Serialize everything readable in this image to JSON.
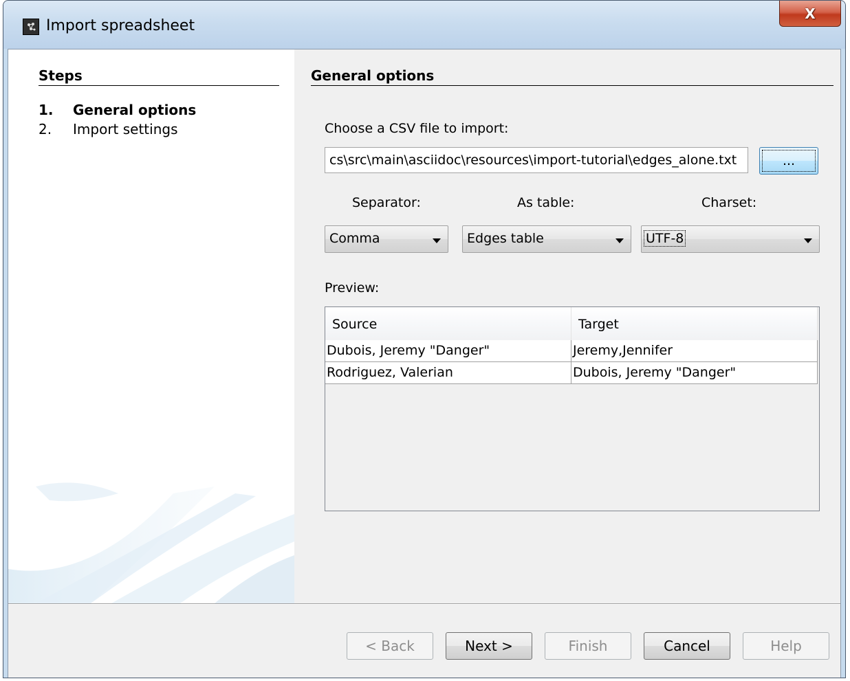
{
  "window": {
    "title": "Import spreadsheet",
    "close_label": "X"
  },
  "steps": {
    "heading": "Steps",
    "items": [
      {
        "number": "1.",
        "label": "General options",
        "active": true
      },
      {
        "number": "2.",
        "label": "Import settings",
        "active": false
      }
    ]
  },
  "main": {
    "heading": "General options",
    "file_prompt": "Choose a CSV file to import:",
    "file_path": "cs\\src\\main\\asciidoc\\resources\\import-tutorial\\edges_alone.txt",
    "browse_label": "...",
    "separator": {
      "label": "Separator:",
      "value": "Comma"
    },
    "as_table": {
      "label": "As table:",
      "value": "Edges table"
    },
    "charset": {
      "label": "Charset:",
      "value": "UTF-8"
    },
    "preview_label": "Preview:",
    "preview": {
      "columns": [
        "Source",
        "Target"
      ],
      "rows": [
        [
          "Dubois, Jeremy \"Danger\"",
          "Jeremy,Jennifer"
        ],
        [
          "Rodriguez, Valerian",
          "Dubois, Jeremy \"Danger\""
        ]
      ]
    }
  },
  "buttons": {
    "back": "< Back",
    "next": "Next >",
    "finish": "Finish",
    "cancel": "Cancel",
    "help": "Help"
  },
  "colors": {
    "title_bar": "#c9dcef",
    "close_button": "#c0391d",
    "panel_background": "#f0f0f0"
  }
}
